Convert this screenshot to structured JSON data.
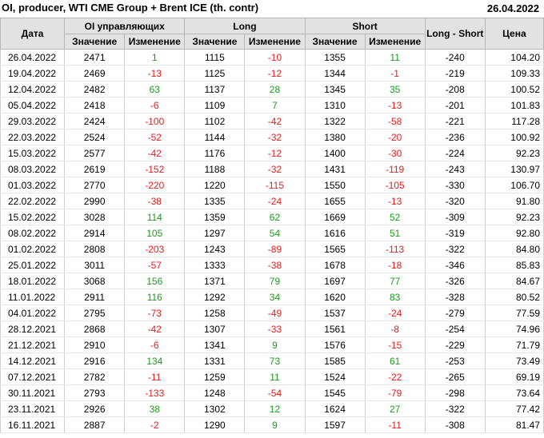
{
  "header": {
    "title": "OI, producer, WTI CME Group + Brent ICE (th. contr)",
    "date": "26.04.2022"
  },
  "columns": {
    "date": "Дата",
    "oi_group": "OI управляющих",
    "long_group": "Long",
    "short_group": "Short",
    "long_short": "Long - Short",
    "price": "Цена",
    "value": "Значение",
    "change": "Изменение"
  },
  "colors": {
    "positive": "#1f9a1f",
    "negative": "#e02020",
    "header_bg": "#e2e2e2"
  },
  "rows": [
    [
      "26.04.2022",
      "2471",
      "1",
      "1115",
      "-10",
      "1355",
      "11",
      "-240",
      "104.20"
    ],
    [
      "19.04.2022",
      "2469",
      "-13",
      "1125",
      "-12",
      "1344",
      "-1",
      "-219",
      "109.33"
    ],
    [
      "12.04.2022",
      "2482",
      "63",
      "1137",
      "28",
      "1345",
      "35",
      "-208",
      "100.52"
    ],
    [
      "05.04.2022",
      "2418",
      "-6",
      "1109",
      "7",
      "1310",
      "-13",
      "-201",
      "101.83"
    ],
    [
      "29.03.2022",
      "2424",
      "-100",
      "1102",
      "-42",
      "1322",
      "-58",
      "-221",
      "117.28"
    ],
    [
      "22.03.2022",
      "2524",
      "-52",
      "1144",
      "-32",
      "1380",
      "-20",
      "-236",
      "100.92"
    ],
    [
      "15.03.2022",
      "2577",
      "-42",
      "1176",
      "-12",
      "1400",
      "-30",
      "-224",
      "92.23"
    ],
    [
      "08.03.2022",
      "2619",
      "-152",
      "1188",
      "-32",
      "1431",
      "-119",
      "-243",
      "130.97"
    ],
    [
      "01.03.2022",
      "2770",
      "-220",
      "1220",
      "-115",
      "1550",
      "-105",
      "-330",
      "106.70"
    ],
    [
      "22.02.2022",
      "2990",
      "-38",
      "1335",
      "-24",
      "1655",
      "-13",
      "-320",
      "91.80"
    ],
    [
      "15.02.2022",
      "3028",
      "114",
      "1359",
      "62",
      "1669",
      "52",
      "-309",
      "92.23"
    ],
    [
      "08.02.2022",
      "2914",
      "105",
      "1297",
      "54",
      "1616",
      "51",
      "-319",
      "92.80"
    ],
    [
      "01.02.2022",
      "2808",
      "-203",
      "1243",
      "-89",
      "1565",
      "-113",
      "-322",
      "84.80"
    ],
    [
      "25.01.2022",
      "3011",
      "-57",
      "1333",
      "-38",
      "1678",
      "-18",
      "-346",
      "85.83"
    ],
    [
      "18.01.2022",
      "3068",
      "156",
      "1371",
      "79",
      "1697",
      "77",
      "-326",
      "84.67"
    ],
    [
      "11.01.2022",
      "2911",
      "116",
      "1292",
      "34",
      "1620",
      "83",
      "-328",
      "80.52"
    ],
    [
      "04.01.2022",
      "2795",
      "-73",
      "1258",
      "-49",
      "1537",
      "-24",
      "-279",
      "77.59"
    ],
    [
      "28.12.2021",
      "2868",
      "-42",
      "1307",
      "-33",
      "1561",
      "-8",
      "-254",
      "74.96"
    ],
    [
      "21.12.2021",
      "2910",
      "-6",
      "1341",
      "9",
      "1576",
      "-15",
      "-229",
      "71.79"
    ],
    [
      "14.12.2021",
      "2916",
      "134",
      "1331",
      "73",
      "1585",
      "61",
      "-253",
      "73.49"
    ],
    [
      "07.12.2021",
      "2782",
      "-11",
      "1259",
      "11",
      "1524",
      "-22",
      "-265",
      "69.19"
    ],
    [
      "30.11.2021",
      "2793",
      "-133",
      "1248",
      "-54",
      "1545",
      "-79",
      "-298",
      "73.64"
    ],
    [
      "23.11.2021",
      "2926",
      "38",
      "1302",
      "12",
      "1624",
      "27",
      "-322",
      "77.42"
    ],
    [
      "16.11.2021",
      "2887",
      "-2",
      "1290",
      "9",
      "1597",
      "-11",
      "-308",
      "81.47"
    ]
  ],
  "separator_before_rows": [
    4,
    8,
    13,
    17
  ]
}
